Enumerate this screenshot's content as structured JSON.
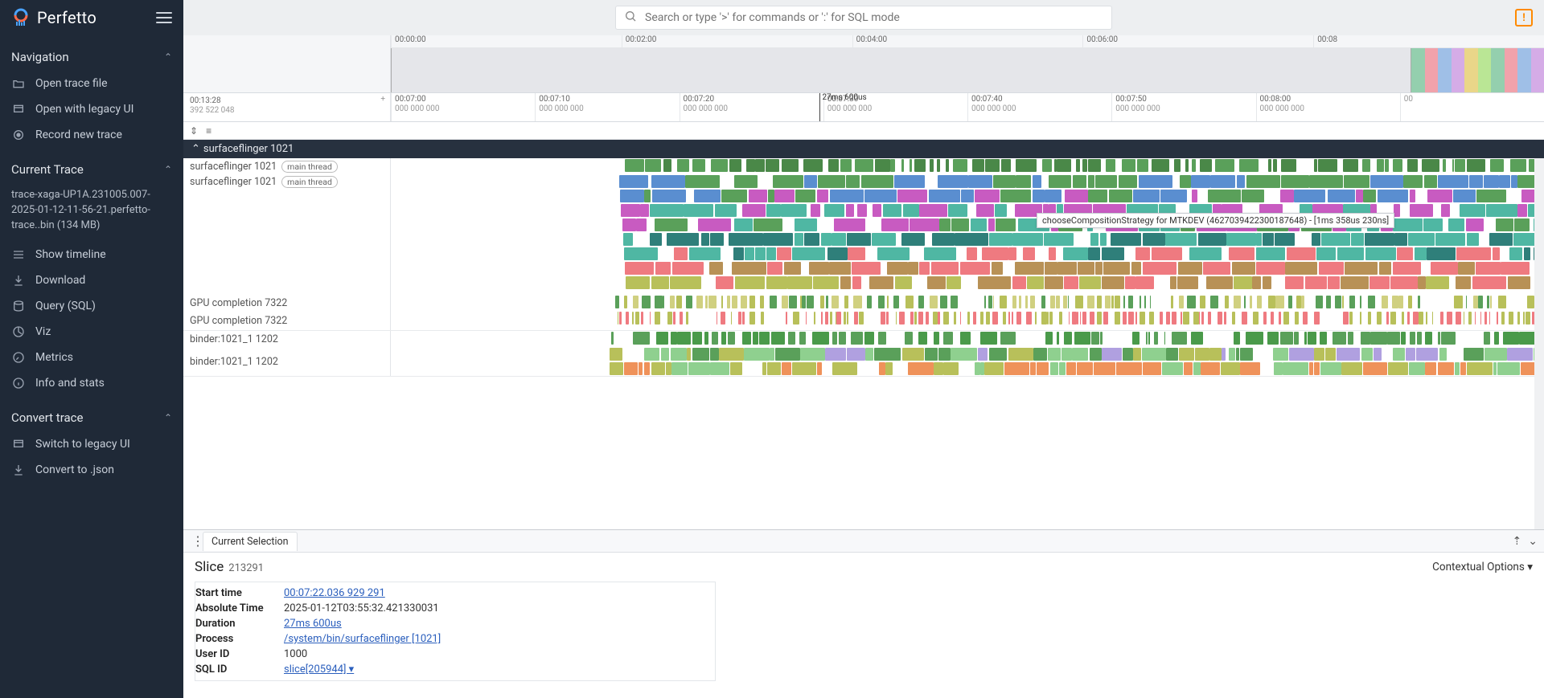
{
  "brand": "Perfetto",
  "search": {
    "placeholder": "Search or type '>' for commands or ':' for SQL mode"
  },
  "sidebar": {
    "sections": {
      "navigation": {
        "title": "Navigation",
        "items": [
          "Open trace file",
          "Open with legacy UI",
          "Record new trace"
        ]
      },
      "current": {
        "title": "Current Trace",
        "filename": "trace-xaga-UP1A.231005.007-2025-01-12-11-56-21.perfetto-trace..bin (134 MB)",
        "items": [
          "Show timeline",
          "Download",
          "Query (SQL)",
          "Viz",
          "Metrics",
          "Info and stats"
        ]
      },
      "convert": {
        "title": "Convert trace",
        "items": [
          "Switch to legacy UI",
          "Convert to .json"
        ]
      }
    }
  },
  "overview": {
    "ticks": [
      "00:00:00",
      "00:02:00",
      "00:04:00",
      "00:06:00",
      "00:08"
    ],
    "range": {
      "leftPct": 0,
      "widthPct": 88.5
    },
    "thumbColors": [
      "#6bbf8e",
      "#f07f8a",
      "#7aa8e0",
      "#c78de0",
      "#e6c95a",
      "#a1e06b",
      "#6bbf8e",
      "#f07f8a",
      "#7aa8e0",
      "#c78de0"
    ]
  },
  "ruler": {
    "origin": {
      "t": "00:13:28",
      "sub": "392 522 048",
      "plus": "+"
    },
    "ticks": [
      {
        "t": "00:07:00",
        "sub": "000 000 000"
      },
      {
        "t": "00:07:10",
        "sub": "000 000 000"
      },
      {
        "t": "00:07:20",
        "sub": "000 000 000"
      },
      {
        "t": "00:07:30",
        "sub": "000 000 000"
      },
      {
        "t": "00:07:40",
        "sub": "000 000 000"
      },
      {
        "t": "00:07:50",
        "sub": "000 000 000"
      },
      {
        "t": "00:08:00",
        "sub": "000 000 000"
      },
      {
        "t": "00"
      }
    ],
    "marker": {
      "leftPct": 37.2,
      "label": "27ms 600us"
    }
  },
  "process": {
    "name": "surfaceflinger 1021"
  },
  "tracks": {
    "sf_main": {
      "label": "surfaceflinger 1021",
      "pill": "main thread"
    },
    "gpu": {
      "label": "GPU completion 7322"
    },
    "binder": {
      "label": "binder:1021_1 1202"
    }
  },
  "tooltip": "chooseCompositionStrategy for MTKDEV (4627039422300187648) - [1ms 358us 230ns]",
  "details": {
    "tab": "Current Selection",
    "heading": "Slice",
    "headingId": "213291",
    "contextual": "Contextual Options",
    "rows": [
      {
        "k": "Start time",
        "v": "00:07:22.036 929 291",
        "link": true
      },
      {
        "k": "Absolute Time",
        "v": "2025-01-12T03:55:32.421330031"
      },
      {
        "k": "Duration",
        "v": "27ms 600us",
        "link": true
      },
      {
        "k": "Process",
        "v": "/system/bin/surfaceflinger [1021]",
        "link": true
      },
      {
        "k": "User ID",
        "v": "1000"
      },
      {
        "k": "SQL ID",
        "v": "slice[205944]",
        "link": true,
        "caret": true
      }
    ]
  },
  "colors": {
    "green": "#5aa05a",
    "blue": "#5a8ed0",
    "magenta": "#c85bc1",
    "teal": "#4fb7a3",
    "deepteal": "#2f7f7a",
    "salmon": "#ef7a80",
    "tan": "#b89156",
    "olive": "#b8c05a",
    "orange": "#ef925a",
    "lav": "#b0a0e0",
    "lightgreen": "#8fd08f"
  }
}
